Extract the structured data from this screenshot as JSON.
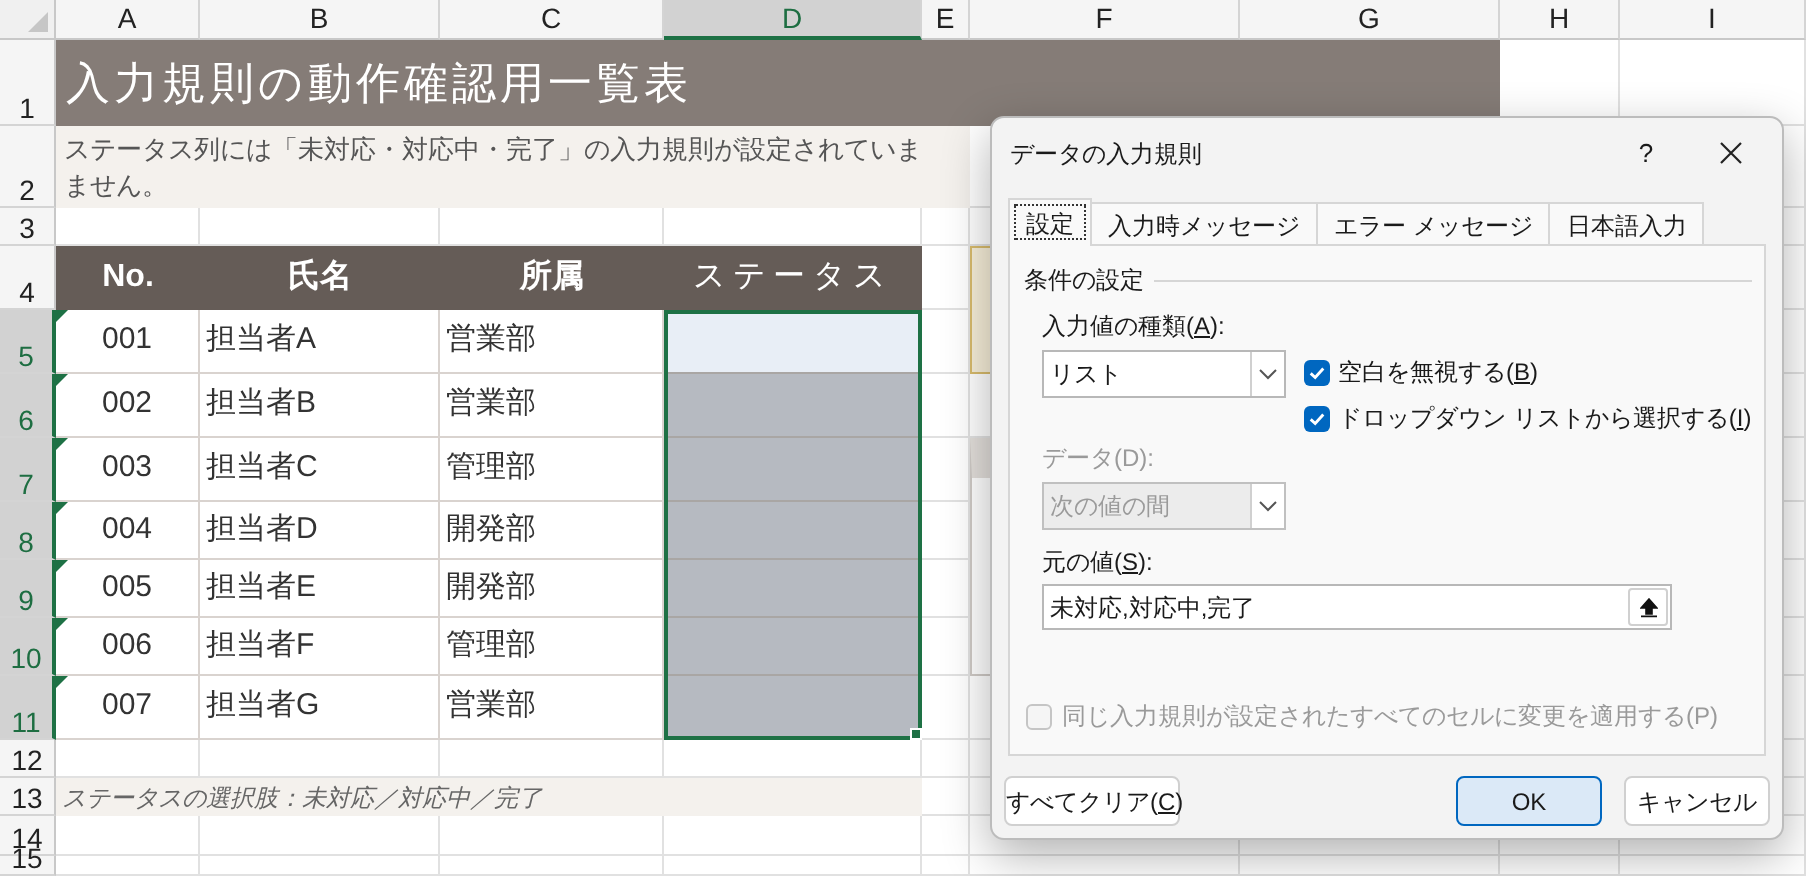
{
  "sheet": {
    "column_headers": [
      {
        "label": "A",
        "selected": false
      },
      {
        "label": "B",
        "selected": false
      },
      {
        "label": "C",
        "selected": false
      },
      {
        "label": "D",
        "selected": true
      },
      {
        "label": "E",
        "selected": false
      },
      {
        "label": "F",
        "selected": false
      },
      {
        "label": "G",
        "selected": false
      },
      {
        "label": "H",
        "selected": false
      },
      {
        "label": "I",
        "selected": false
      }
    ],
    "row_headers": [
      {
        "label": "1",
        "selected": false
      },
      {
        "label": "2",
        "selected": false
      },
      {
        "label": "3",
        "selected": false
      },
      {
        "label": "4",
        "selected": false
      },
      {
        "label": "5",
        "selected": true
      },
      {
        "label": "6",
        "selected": true
      },
      {
        "label": "7",
        "selected": true
      },
      {
        "label": "8",
        "selected": true
      },
      {
        "label": "9",
        "selected": true
      },
      {
        "label": "10",
        "selected": true
      },
      {
        "label": "11",
        "selected": true
      },
      {
        "label": "12",
        "selected": false
      },
      {
        "label": "13",
        "selected": false
      },
      {
        "label": "14",
        "selected": false
      },
      {
        "label": "15",
        "selected": false
      }
    ],
    "title": "入力規則の動作確認用一覧表",
    "description_lines": [
      "ステータス列には「未対応・対応中・完了」の入力規則が設定されていま",
      "ません。"
    ],
    "table": {
      "columns": [
        "No.",
        "氏名",
        "所属",
        "ステータス"
      ],
      "rows": [
        {
          "no": "001",
          "name": "担当者A",
          "department": "営業部",
          "active": true
        },
        {
          "no": "002",
          "name": "担当者B",
          "department": "営業部",
          "active": false
        },
        {
          "no": "003",
          "name": "担当者C",
          "department": "管理部",
          "active": false
        },
        {
          "no": "004",
          "name": "担当者D",
          "department": "開発部",
          "active": false
        },
        {
          "no": "005",
          "name": "担当者E",
          "department": "開発部",
          "active": false
        },
        {
          "no": "006",
          "name": "担当者F",
          "department": "管理部",
          "active": false
        },
        {
          "no": "007",
          "name": "担当者G",
          "department": "営業部",
          "active": false
        }
      ]
    },
    "note": "ステータスの選択肢：未対応／対応中／完了"
  },
  "dialog": {
    "title": "データの入力規則",
    "help": "?",
    "tabs": [
      {
        "label": "設定",
        "selected": true
      },
      {
        "label": "入力時メッセージ",
        "selected": false
      },
      {
        "label": "エラー メッセージ",
        "selected": false
      },
      {
        "label": "日本語入力",
        "selected": false
      }
    ],
    "group_label": "条件の設定",
    "allow_label": {
      "before": "入力値の種類(",
      "key": "A",
      "after": "):"
    },
    "allow_value": "リスト",
    "checkboxes": [
      {
        "before": "空白を無視する(",
        "key": "B",
        "after": ")",
        "checked": true,
        "disabled": false
      },
      {
        "before": "ドロップダウン リストから選択する(",
        "key": "I",
        "after": ")",
        "checked": true,
        "disabled": false
      }
    ],
    "data_label": {
      "text": "データ(D):",
      "disabled": true
    },
    "data_value": {
      "text": "次の値の間",
      "disabled": true
    },
    "source_label": {
      "before": "元の値(",
      "key": "S",
      "after": "):"
    },
    "source_value": "未対応,対応中,完了",
    "apply_all": {
      "text": "同じ入力規則が設定されたすべてのセルに変更を適用する(P)",
      "checked": false,
      "disabled": true
    },
    "buttons": [
      {
        "before": "すべてクリア(",
        "key": "C",
        "after": ")",
        "kind": "left"
      },
      {
        "text": "OK",
        "kind": "default"
      },
      {
        "text": "キャンセル",
        "kind": "normal"
      }
    ]
  }
}
